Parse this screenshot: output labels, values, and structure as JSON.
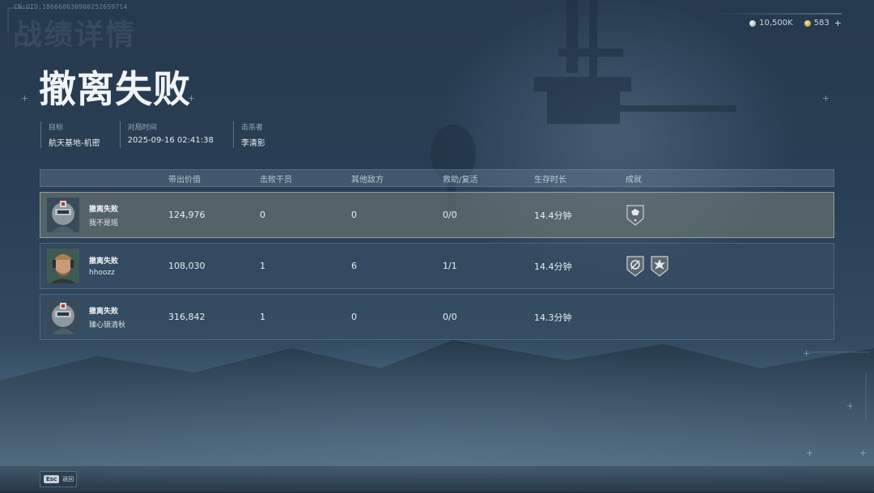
{
  "cnid": "CN:UID:186660630900252659714",
  "bg_title": "战绩详情",
  "title": "撤离失败",
  "currency": {
    "silver_value": "10,500K",
    "silver_icon": "silver-coin-icon",
    "gold_value": "583",
    "gold_icon": "gold-coin-icon",
    "add_label": "+"
  },
  "meta": [
    {
      "label": "目标",
      "value": "航天基地-机密"
    },
    {
      "label": "对局时间",
      "value": "2025-09-16 02:41:38"
    },
    {
      "label": "击杀者",
      "value": "李清影"
    }
  ],
  "table": {
    "headers": [
      "带出价值",
      "击败干员",
      "其他敌方",
      "救助/复活",
      "生存时长",
      "成就"
    ],
    "rows": [
      {
        "status": "撤离失败",
        "name": "我不是瑶",
        "value": "124,976",
        "kills": "0",
        "enemies": "0",
        "assist": "0/0",
        "time": "14.4分钟",
        "badges": [
          "achievement-badge-icon"
        ],
        "highlight": true
      },
      {
        "status": "撤离失败",
        "name": "hhoozz",
        "value": "108,030",
        "kills": "1",
        "enemies": "6",
        "assist": "1/1",
        "time": "14.4分钟",
        "badges": [
          "achievement-badge-icon",
          "achievement-badge-icon"
        ],
        "highlight": false
      },
      {
        "status": "撤离失败",
        "name": "臻心锁清秋",
        "value": "316,842",
        "kills": "1",
        "enemies": "0",
        "assist": "0/0",
        "time": "14.3分钟",
        "badges": [],
        "highlight": false
      }
    ]
  },
  "footer": {
    "esc_key": "Esc",
    "esc_label": "返回"
  }
}
